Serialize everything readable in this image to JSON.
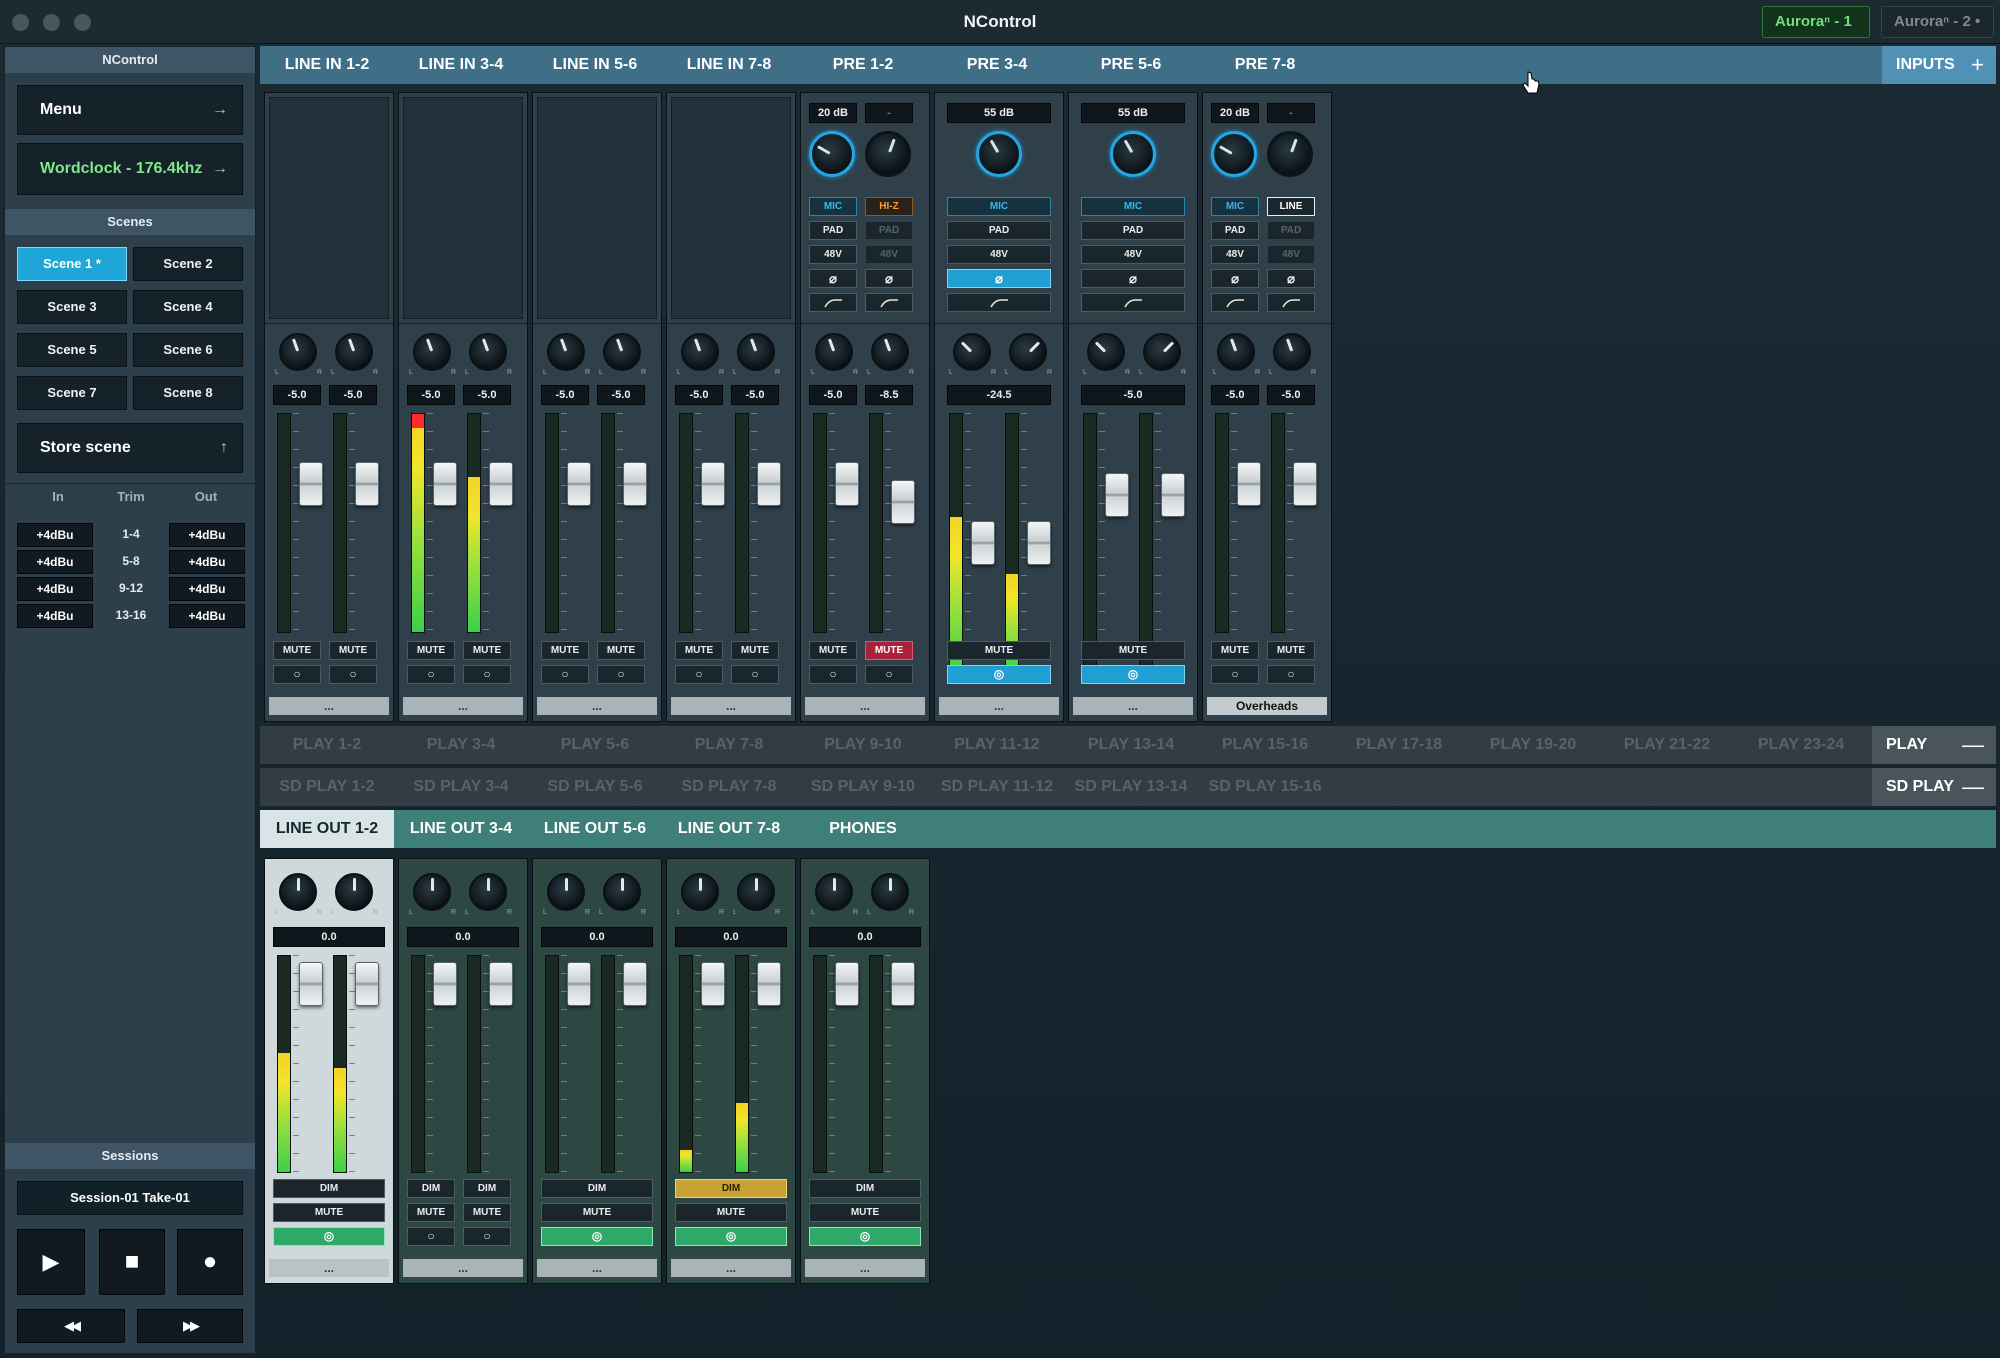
{
  "window": {
    "title": "NControl",
    "devices": [
      "Auroraⁿ - 1 •",
      "Auroraⁿ - 2 •"
    ]
  },
  "sidebar": {
    "header": "NControl",
    "menu_label": "Menu",
    "wordclock_label": "Wordclock - 176.4khz",
    "scenes_header": "Scenes",
    "scenes": [
      "Scene 1 *",
      "Scene 2",
      "Scene 3",
      "Scene 4",
      "Scene 5",
      "Scene 6",
      "Scene 7",
      "Scene 8"
    ],
    "store_label": "Store scene",
    "trim": {
      "headers": [
        "In",
        "Trim",
        "Out"
      ],
      "rows": [
        [
          "+4dBu",
          "1-4",
          "+4dBu"
        ],
        [
          "+4dBu",
          "5-8",
          "+4dBu"
        ],
        [
          "+4dBu",
          "9-12",
          "+4dBu"
        ],
        [
          "+4dBu",
          "13-16",
          "+4dBu"
        ]
      ]
    },
    "sessions_header": "Sessions",
    "session_name": "Session-01 Take-01",
    "icons": {
      "play": "▶",
      "stop": "■",
      "record": "●",
      "rewind": "◀◀",
      "forward": "▶▶",
      "arrow_right": "→",
      "arrow_up": "↑"
    }
  },
  "inputs": {
    "tabs": [
      "LINE IN 1-2",
      "LINE IN 3-4",
      "LINE IN 5-6",
      "LINE IN 7-8",
      "PRE 1-2",
      "PRE 3-4",
      "PRE 5-6",
      "PRE 7-8"
    ],
    "button": "INPUTS",
    "button_icon": "+",
    "strips": [
      {
        "pre": false,
        "pan": [
          "-5.0",
          "-5.0"
        ],
        "mute": [
          "MUTE",
          "MUTE"
        ],
        "levels": [
          0,
          0
        ],
        "faders": [
          0.72,
          0.72
        ],
        "name": "..."
      },
      {
        "pre": false,
        "pan": [
          "-5.0",
          "-5.0"
        ],
        "mute": [
          "MUTE",
          "MUTE"
        ],
        "levels": [
          1.0,
          0.71
        ],
        "faders": [
          0.72,
          0.72
        ],
        "name": "..."
      },
      {
        "pre": false,
        "pan": [
          "-5.0",
          "-5.0"
        ],
        "mute": [
          "MUTE",
          "MUTE"
        ],
        "levels": [
          0,
          0
        ],
        "faders": [
          0.72,
          0.72
        ],
        "name": "..."
      },
      {
        "pre": false,
        "pan": [
          "-5.0",
          "-5.0"
        ],
        "mute": [
          "MUTE",
          "MUTE"
        ],
        "levels": [
          0,
          0
        ],
        "faders": [
          0.72,
          0.72
        ],
        "name": "..."
      },
      {
        "pre": true,
        "linked": false,
        "gain": [
          "20 dB",
          "-"
        ],
        "mode": [
          "MIC",
          "HI-Z"
        ],
        "pad": [
          "PAD",
          "PAD"
        ],
        "phantom": [
          "48V",
          "48V"
        ],
        "pan": [
          "-5.0",
          "-8.5"
        ],
        "mute": [
          "MUTE",
          "MUTE"
        ],
        "mute_on": [
          false,
          true
        ],
        "levels": [
          0,
          0
        ],
        "faders": [
          0.72,
          0.62
        ],
        "name": "..."
      },
      {
        "pre": true,
        "linked": true,
        "gain": [
          "55 dB"
        ],
        "mode": [
          "MIC"
        ],
        "pad": [
          "PAD"
        ],
        "phantom": [
          "48V"
        ],
        "pan": [
          "-24.5"
        ],
        "mute": [
          "MUTE"
        ],
        "phase_on": true,
        "link_on": true,
        "levels": [
          0.6,
          0.38
        ],
        "faders": [
          0.5,
          0.5
        ],
        "name": "..."
      },
      {
        "pre": true,
        "linked": true,
        "gain": [
          "55 dB"
        ],
        "mode": [
          "MIC"
        ],
        "pad": [
          "PAD"
        ],
        "phantom": [
          "48V"
        ],
        "pan": [
          "-5.0"
        ],
        "mute": [
          "MUTE"
        ],
        "phase_on": false,
        "link_on": true,
        "levels": [
          0,
          0
        ],
        "faders": [
          0.72,
          0.72
        ],
        "name": "..."
      },
      {
        "pre": true,
        "linked": false,
        "gain": [
          "20 dB",
          "-"
        ],
        "mode": [
          "MIC",
          "LINE"
        ],
        "pad": [
          "PAD",
          "PAD"
        ],
        "phantom": [
          "48V",
          "48V"
        ],
        "pan": [
          "-5.0",
          "-5.0"
        ],
        "mute": [
          "MUTE",
          "MUTE"
        ],
        "mute_on": [
          false,
          false
        ],
        "levels": [
          0,
          0
        ],
        "faders": [
          0.72,
          0.72
        ],
        "name": "Overheads"
      }
    ]
  },
  "play": {
    "tabs": [
      "PLAY 1-2",
      "PLAY 3-4",
      "PLAY 5-6",
      "PLAY 7-8",
      "PLAY 9-10",
      "PLAY 11-12",
      "PLAY 13-14",
      "PLAY 15-16",
      "PLAY 17-18",
      "PLAY 19-20",
      "PLAY 21-22",
      "PLAY 23-24"
    ],
    "button": "PLAY",
    "button_icon": "—"
  },
  "sdplay": {
    "tabs": [
      "SD PLAY 1-2",
      "SD PLAY 3-4",
      "SD PLAY 5-6",
      "SD PLAY 7-8",
      "SD PLAY 9-10",
      "SD PLAY 11-12",
      "SD PLAY 13-14",
      "SD PLAY 15-16"
    ],
    "button": "SD PLAY",
    "button_icon": "—"
  },
  "outputs": {
    "tabs": [
      "LINE OUT 1-2",
      "LINE OUT 3-4",
      "LINE OUT 5-6",
      "LINE OUT 7-8",
      "PHONES"
    ],
    "strips": [
      {
        "value": "0.0",
        "linked": true,
        "dim": "DIM",
        "dim_on": false,
        "mute": "MUTE",
        "levels": [
          0.55,
          0.48
        ],
        "selected": true,
        "name": "..."
      },
      {
        "value": "0.0",
        "linked": false,
        "dim": "DIM",
        "dim_on": false,
        "mute": "MUTE",
        "levels": [
          0,
          0
        ],
        "selected": false,
        "name": "..."
      },
      {
        "value": "0.0",
        "linked": true,
        "dim": "DIM",
        "dim_on": false,
        "mute": "MUTE",
        "levels": [
          0,
          0
        ],
        "selected": false,
        "name": "..."
      },
      {
        "value": "0.0",
        "linked": true,
        "dim": "DIM",
        "dim_on": true,
        "mute": "MUTE",
        "levels": [
          0.1,
          0.32
        ],
        "selected": false,
        "name": "..."
      },
      {
        "value": "0.0",
        "linked": true,
        "dim": "DIM",
        "dim_on": false,
        "mute": "MUTE",
        "levels": [
          0,
          0
        ],
        "selected": false,
        "name": "..."
      }
    ]
  },
  "colors": {
    "accent": "#1ea6d8",
    "active_green": "#6fe07a",
    "mute_red": "#a9213a",
    "dim_gold": "#c9a235"
  }
}
